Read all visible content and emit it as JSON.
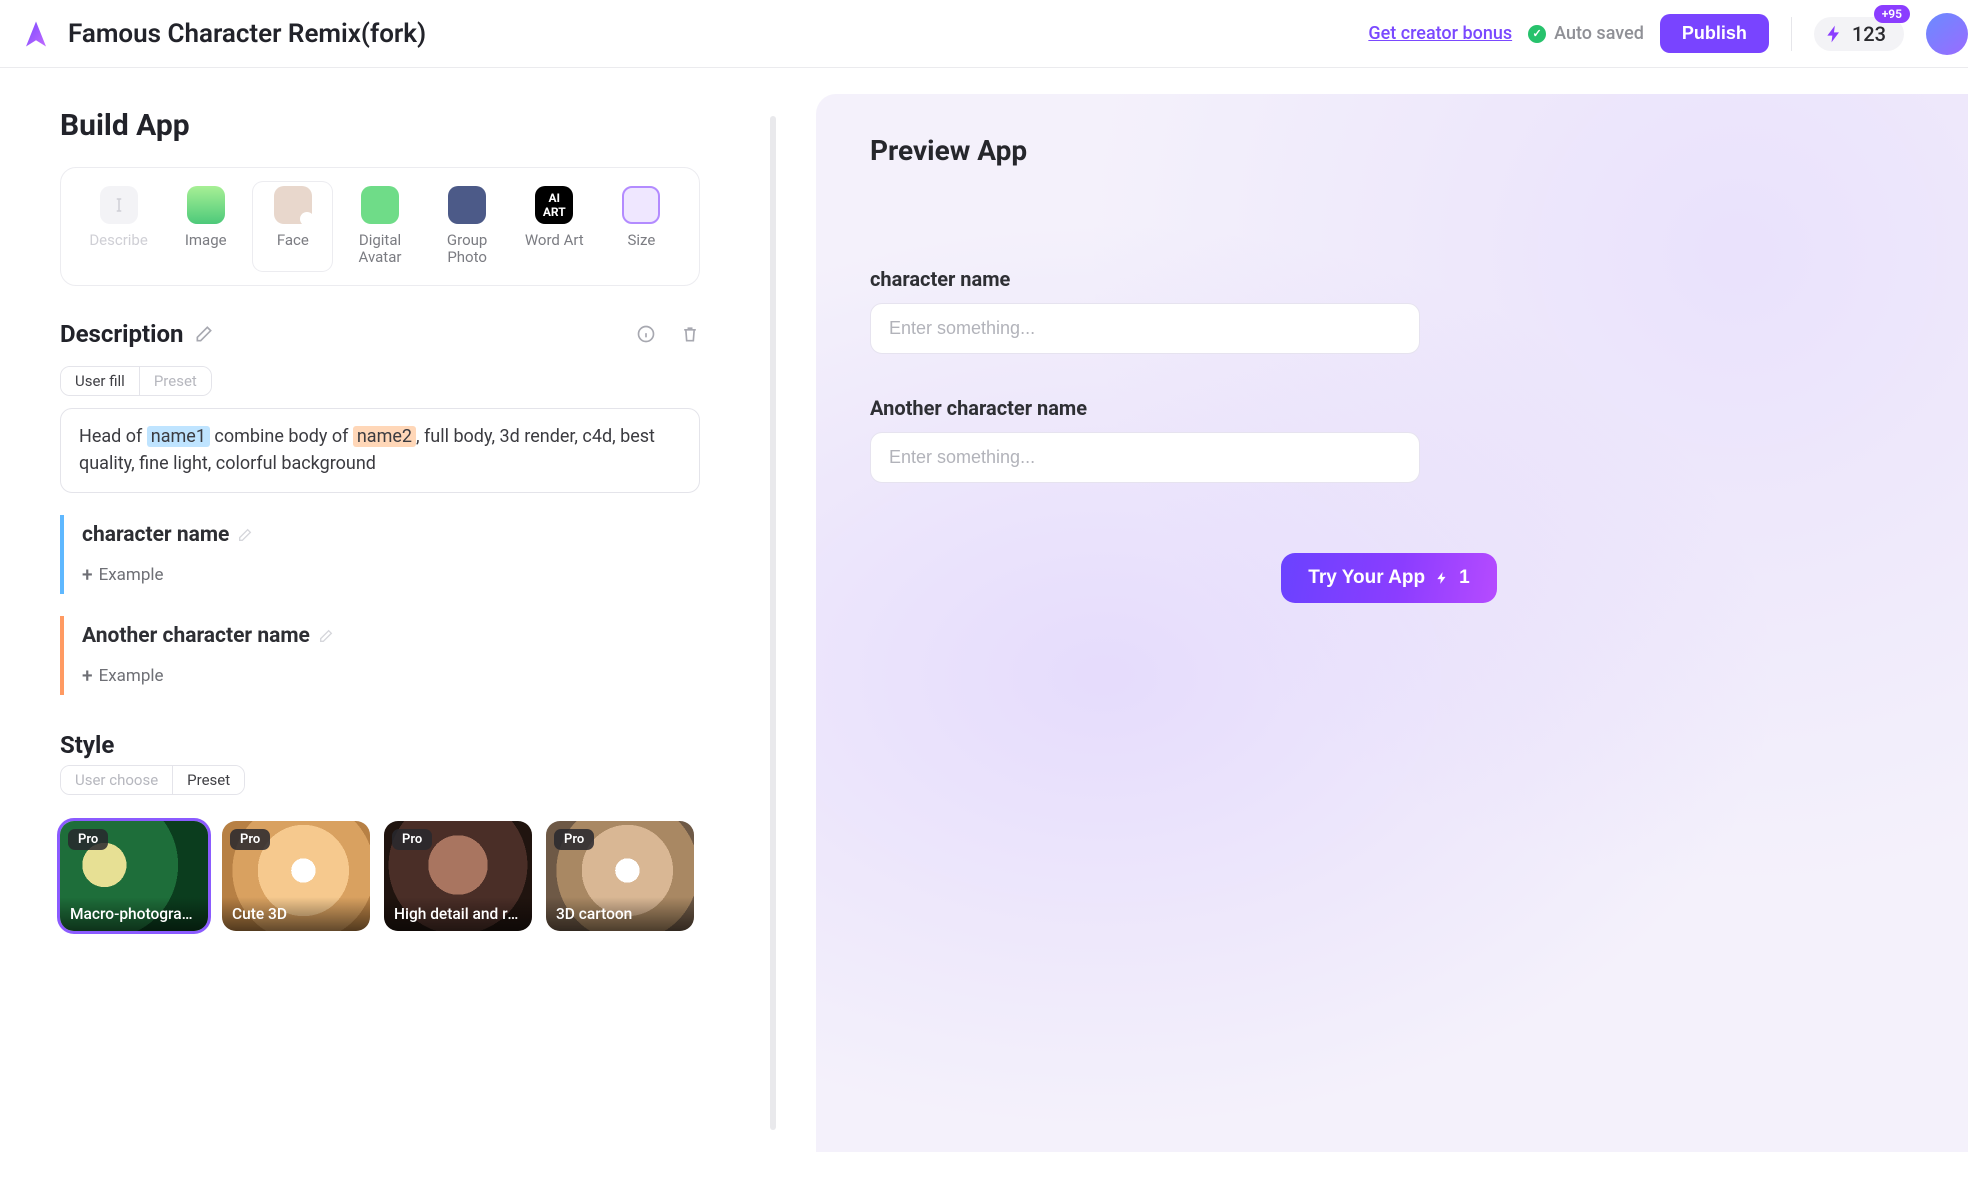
{
  "header": {
    "title": "Famous Character Remix(fork)",
    "creator_bonus_label": "Get creator bonus",
    "autosave_label": "Auto saved",
    "publish_label": "Publish",
    "credits_value": "123",
    "credits_badge": "+95"
  },
  "build": {
    "heading": "Build App",
    "components": [
      {
        "key": "describe",
        "label": "Describe"
      },
      {
        "key": "image",
        "label": "Image"
      },
      {
        "key": "face",
        "label": "Face"
      },
      {
        "key": "avatar",
        "label": "Digital Avatar"
      },
      {
        "key": "group",
        "label": "Group Photo"
      },
      {
        "key": "wordart",
        "label": "Word Art"
      },
      {
        "key": "size",
        "label": "Size"
      }
    ],
    "description": {
      "heading": "Description",
      "toggle": {
        "options": [
          "User fill",
          "Preset"
        ],
        "active": "User fill"
      },
      "prompt_pre": "Head of ",
      "prompt_tok1": "name1",
      "prompt_mid": " combine body of ",
      "prompt_tok2": "name2",
      "prompt_post": ", full body, 3d render, c4d, best quality, fine light, colorful background",
      "variables": [
        {
          "title": "character name",
          "color": "blue",
          "example_label": "Example"
        },
        {
          "title": "Another character name",
          "color": "orange",
          "example_label": "Example"
        }
      ]
    },
    "style": {
      "heading": "Style",
      "toggle": {
        "options": [
          "User choose",
          "Preset"
        ],
        "active": "Preset"
      },
      "pro_tag": "Pro",
      "cards": [
        {
          "caption": "Macro-photography",
          "bg": "bg-parrot",
          "selected": true
        },
        {
          "caption": "Cute 3D",
          "bg": "bg-dog3d",
          "selected": false
        },
        {
          "caption": "High detail and re...",
          "bg": "bg-real",
          "selected": false
        },
        {
          "caption": "3D cartoon",
          "bg": "bg-cart",
          "selected": false
        }
      ]
    }
  },
  "preview": {
    "heading": "Preview App",
    "fields": [
      {
        "label": "character name",
        "placeholder": "Enter something..."
      },
      {
        "label": "Another character name",
        "placeholder": "Enter something..."
      }
    ],
    "try_label": "Try Your App",
    "try_cost": "1"
  }
}
